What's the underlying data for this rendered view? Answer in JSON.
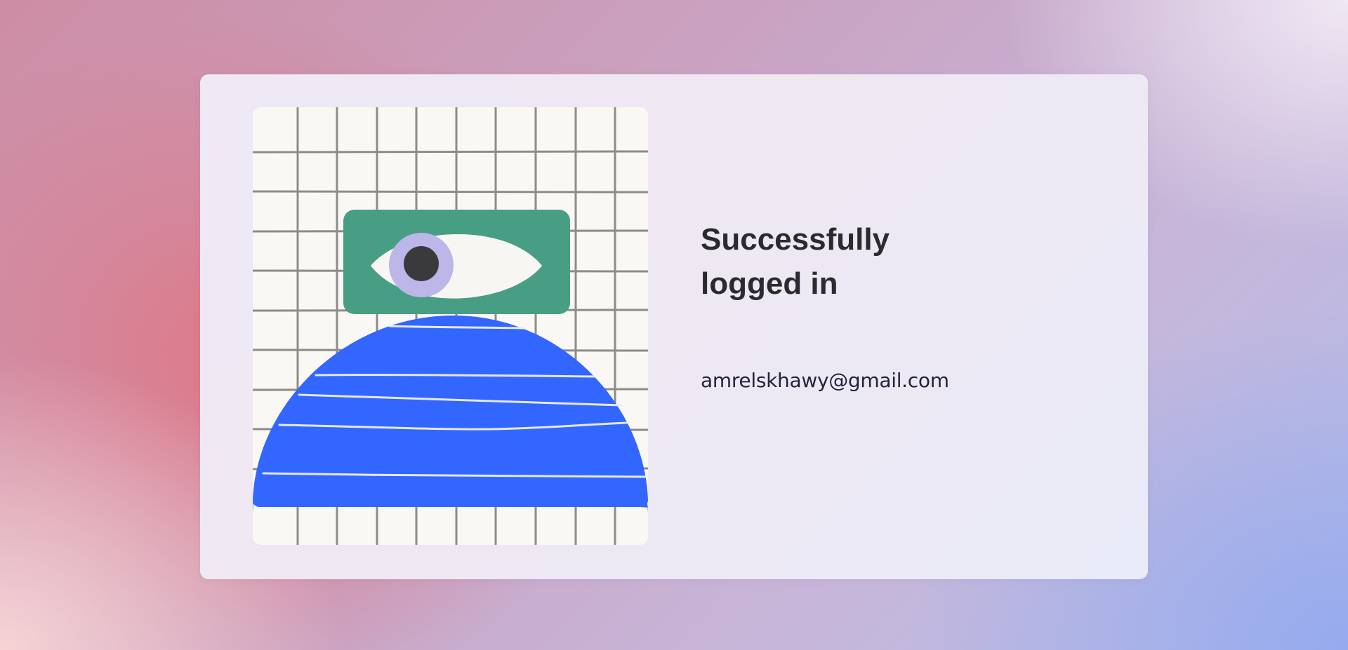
{
  "login_status": {
    "title": "Successfully logged in",
    "email": "amrelskhawy@gmail.com"
  },
  "illustration": {
    "icon": "eye-illustration",
    "colors": {
      "paper": "#faf8f5",
      "grid": "#8e8c88",
      "eye_panel": "#489e85",
      "eye_white": "#f7f6f2",
      "iris": "#bdb6e8",
      "pupil": "#3a3a3c",
      "dome": "#3366ff",
      "dome_stripes": "#e6e8f6"
    }
  }
}
